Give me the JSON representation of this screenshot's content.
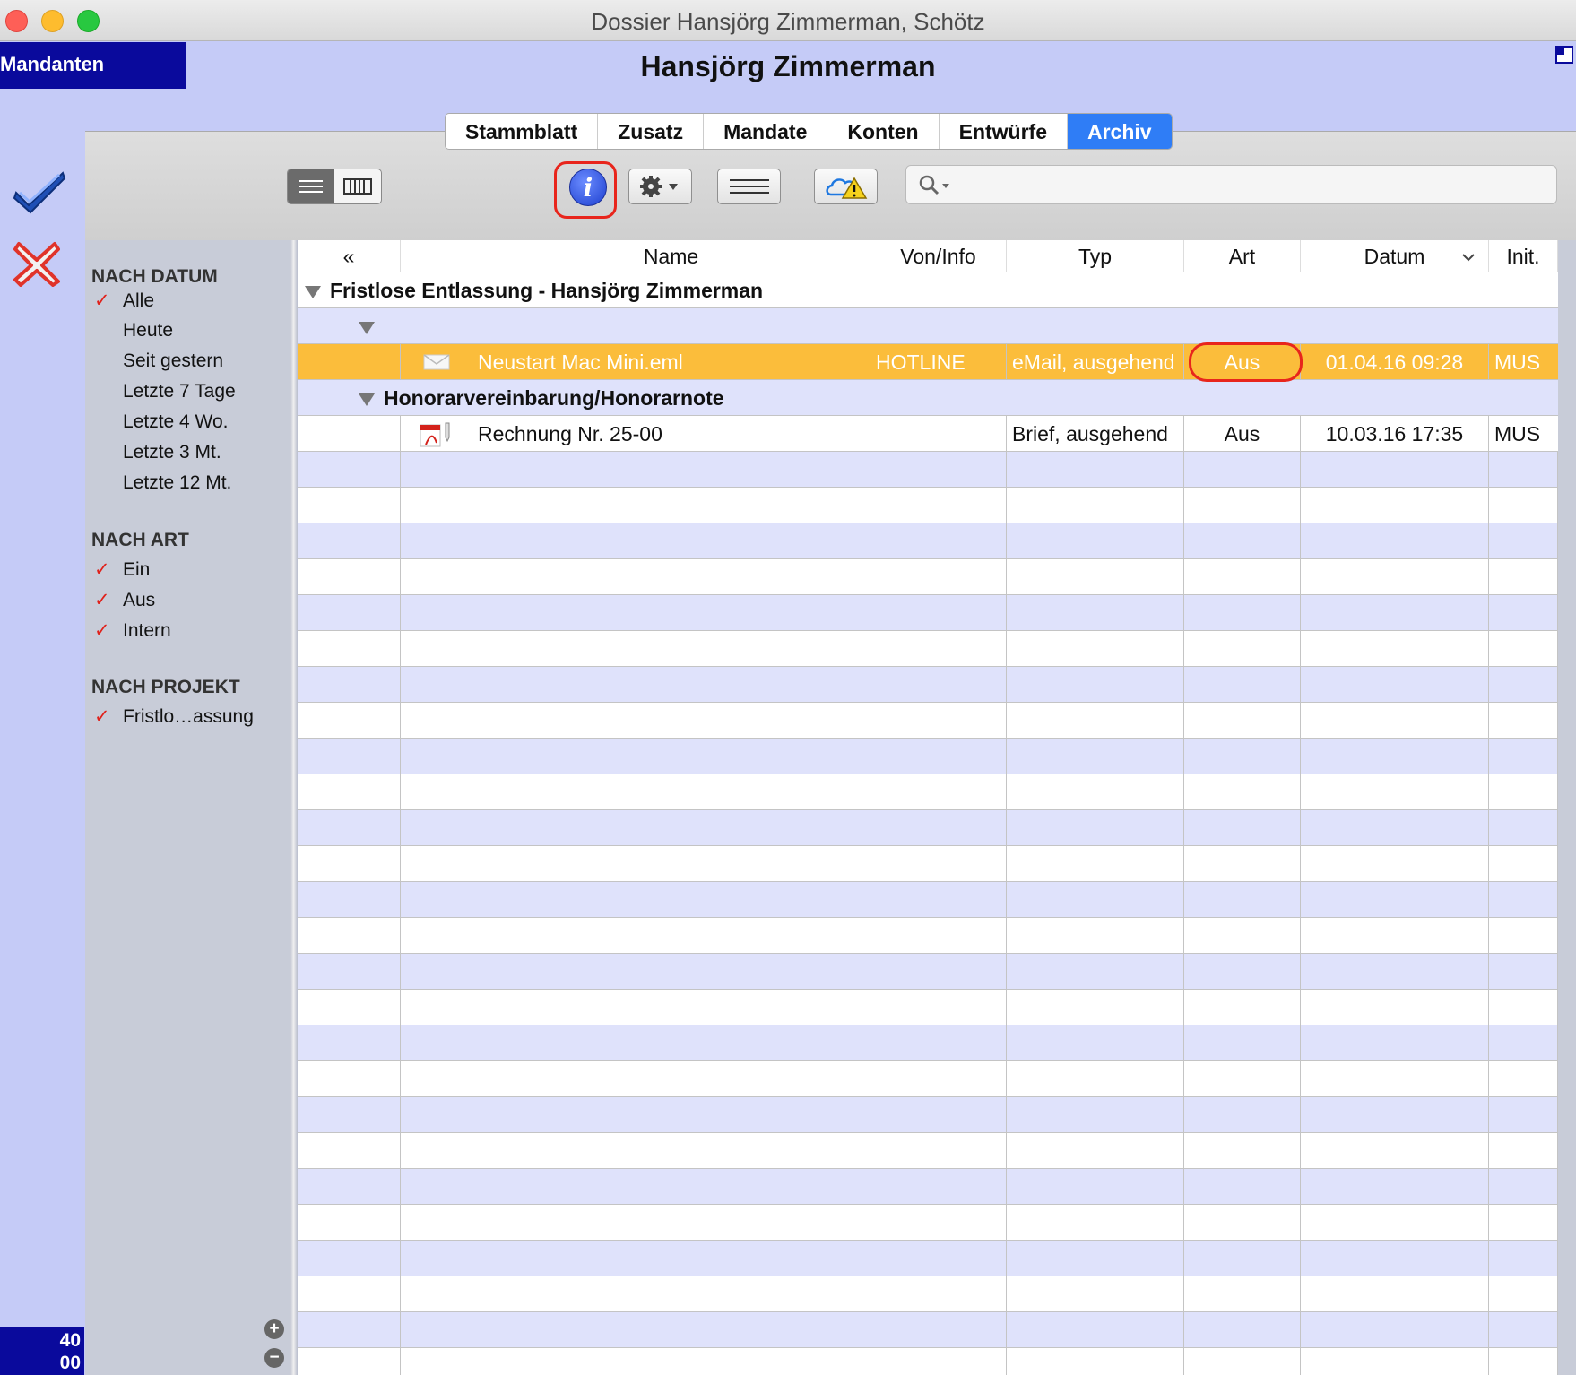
{
  "window": {
    "title": "Dossier Hansjörg Zimmerman, Schötz"
  },
  "header": {
    "mandanten_label": "Mandanten",
    "person_name": "Hansjörg Zimmerman"
  },
  "tabs": [
    {
      "label": "Stammblatt"
    },
    {
      "label": "Zusatz"
    },
    {
      "label": "Mandate"
    },
    {
      "label": "Konten"
    },
    {
      "label": "Entwürfe"
    },
    {
      "label": "Archiv"
    }
  ],
  "active_tab": "Archiv",
  "search": {
    "placeholder": ""
  },
  "sidebar": {
    "sections": [
      {
        "title": "NACH DATUM",
        "items": [
          {
            "label": "Alle",
            "checked": true
          },
          {
            "label": "Heute",
            "checked": false
          },
          {
            "label": "Seit gestern",
            "checked": false
          },
          {
            "label": "Letzte 7 Tage",
            "checked": false
          },
          {
            "label": "Letzte 4 Wo.",
            "checked": false
          },
          {
            "label": "Letzte 3 Mt.",
            "checked": false
          },
          {
            "label": "Letzte 12 Mt.",
            "checked": false
          }
        ]
      },
      {
        "title": "NACH ART",
        "items": [
          {
            "label": "Ein",
            "checked": true
          },
          {
            "label": "Aus",
            "checked": true
          },
          {
            "label": "Intern",
            "checked": true
          }
        ]
      },
      {
        "title": "NACH PROJEKT",
        "items": [
          {
            "label": "Fristlo…assung",
            "checked": true
          }
        ]
      }
    ],
    "check_glyph": "✓"
  },
  "counter": {
    "line1": "40",
    "line2": "00"
  },
  "table": {
    "columns": [
      "«",
      "",
      "Name",
      "Von/Info",
      "Typ",
      "Art",
      "Datum",
      "Init."
    ],
    "groups": [
      {
        "title": "Fristlose Entlassung - Hansjörg Zimmerman"
      },
      {
        "title": ""
      },
      {
        "title": "Honorarvereinbarung/Honorarnote"
      }
    ],
    "rows": [
      {
        "icon": "mail-icon",
        "name": "Neustart Mac Mini.eml",
        "von": "HOTLINE",
        "typ": "eMail, ausgehend",
        "art": "Aus",
        "datum": "01.04.16 09:28",
        "init": "MUS",
        "selected": true
      },
      {
        "icon": "pdf-icon",
        "name": "Rechnung Nr. 25-00",
        "von": "",
        "typ": "Brief, ausgehend",
        "art": "Aus",
        "datum": "10.03.16 17:35",
        "init": "MUS",
        "selected": false
      }
    ]
  },
  "colors": {
    "accent": "#2f7df6",
    "selection": "#fbbd3b",
    "highlight_ring": "#e8251c",
    "navy": "#0a0a9c"
  }
}
